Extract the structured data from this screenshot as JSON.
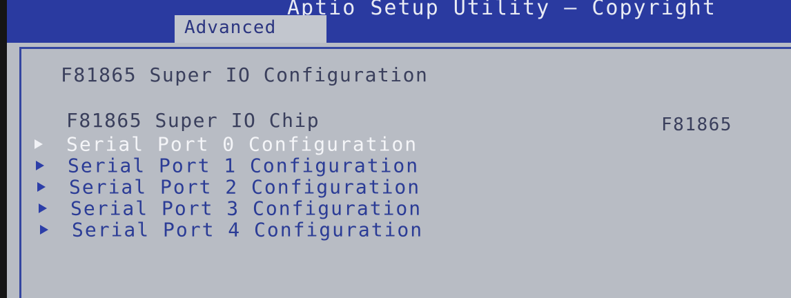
{
  "header": {
    "title": "Aptio Setup Utility – Copyright",
    "tab": "Advanced"
  },
  "panel": {
    "heading": "F81865 Super IO Configuration",
    "chip_label": "F81865 Super IO Chip",
    "chip_value": "F81865",
    "items": [
      {
        "label": "Serial Port 0 Configuration",
        "selected": true
      },
      {
        "label": "Serial Port 1 Configuration",
        "selected": false
      },
      {
        "label": "Serial Port 2 Configuration",
        "selected": false
      },
      {
        "label": "Serial Port 3 Configuration",
        "selected": false
      },
      {
        "label": "Serial Port 4 Configuration",
        "selected": false
      }
    ]
  },
  "colors": {
    "header_bg": "#2a3aa0",
    "panel_bg": "#b8bcc4",
    "menu_text": "#2b3c96",
    "selected_text": "#f4f5f8"
  }
}
